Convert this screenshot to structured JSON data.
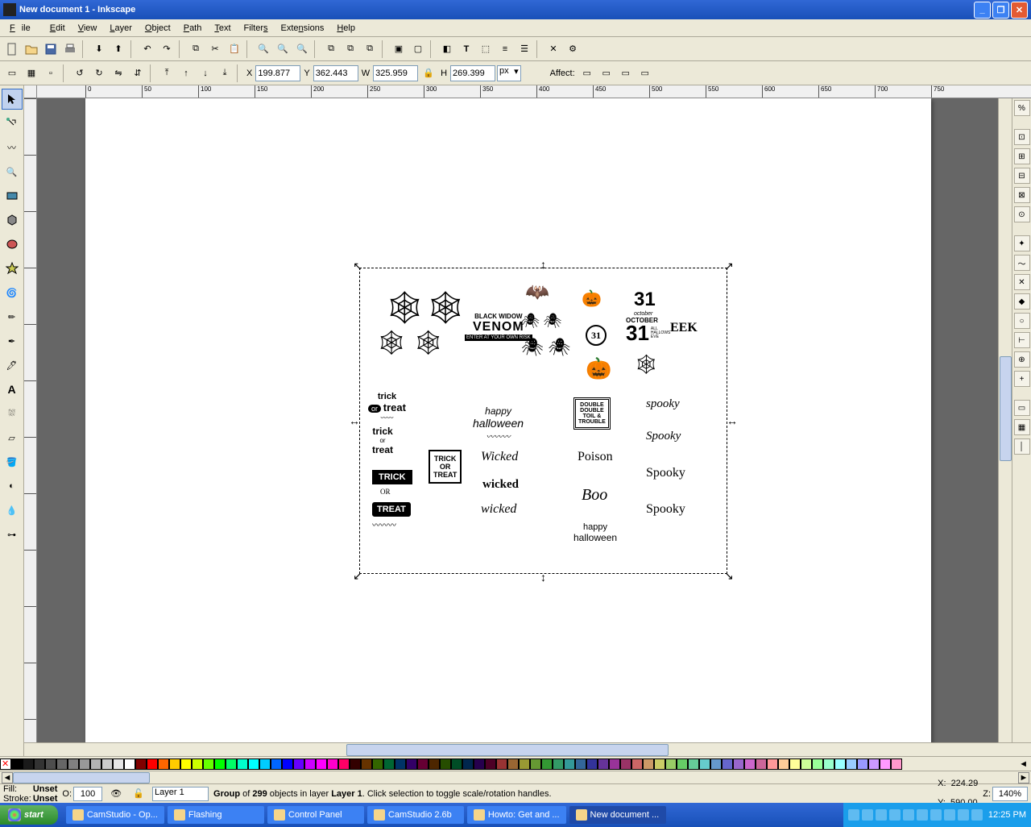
{
  "window": {
    "title": "New document 1 - Inkscape"
  },
  "menu": {
    "file": "File",
    "edit": "Edit",
    "view": "View",
    "layer": "Layer",
    "object": "Object",
    "path": "Path",
    "text": "Text",
    "filters": "Filters",
    "extensions": "Extensions",
    "help": "Help"
  },
  "coords": {
    "x_label": "X",
    "x": "199.877",
    "y_label": "Y",
    "y": "362.443",
    "w_label": "W",
    "w": "325.959",
    "h_label": "H",
    "h": "269.399",
    "unit": "px",
    "affect_label": "Affect:"
  },
  "status": {
    "fill_label": "Fill:",
    "fill_value": "Unset",
    "stroke_label": "Stroke:",
    "stroke_value": "Unset",
    "opacity_label": "O:",
    "opacity": "100",
    "layer": "Layer 1",
    "msg_prefix": "Group",
    "msg_of": " of ",
    "msg_count": "299",
    "msg_mid": " objects in layer ",
    "msg_layer": "Layer 1",
    "msg_tail": ". Click selection to toggle scale/rotation handles.",
    "cursor_x_label": "X:",
    "cursor_x": "224.29",
    "cursor_y_label": "Y:",
    "cursor_y": "590.00",
    "zoom_label": "Z:",
    "zoom": "140%"
  },
  "taskbar": {
    "start": "start",
    "items": [
      "CamStudio - Op...",
      "Flashing",
      "Control Panel",
      "CamStudio 2.6b",
      "Howto: Get and ...",
      "New document ..."
    ],
    "clock": "12:25 PM"
  },
  "clipart": {
    "venom1": "BLACK WIDOW",
    "venom2": "VENOM",
    "venom3": "ENTER AT YOUR OWN RISK",
    "thirtyone": "31",
    "oct_small": "october",
    "oct_word": "OCTOBER",
    "oct_big": "31",
    "oct_sub": "ALL\nHALLOWS\nEVE",
    "eek": "EEK",
    "trick1": "trick",
    "or1": "or",
    "treat1": "treat",
    "trick2": "trick",
    "or2": "or",
    "treat2": "treat",
    "trickbox": "TRICK\nOR\nTREAT",
    "trick3": "TRICK",
    "or3": "OR",
    "treat3": "TREAT",
    "trick4": "TRICK\nor\nTREAT",
    "happyh1": "happy",
    "happyh2": "halloween",
    "wicked1": "Wicked",
    "wicked2": "wicked",
    "wicked3": "wicked",
    "double": "DOUBLE\nDOUBLE\nTOIL &\nTROUBLE",
    "poison": "Poison",
    "boo": "Boo",
    "happyh3": "happy",
    "happyh4": "halloween",
    "spooky1": "spooky",
    "spooky2": "Spooky",
    "spooky3": "Spooky",
    "spooky4": "Spooky"
  },
  "ruler_marks": [
    "0",
    "50",
    "100",
    "150",
    "200",
    "250",
    "300",
    "350",
    "400",
    "450",
    "500",
    "550",
    "600",
    "650",
    "700",
    "750"
  ],
  "palette_colors": [
    "#000000",
    "#1a1a1a",
    "#333333",
    "#4d4d4d",
    "#666666",
    "#808080",
    "#999999",
    "#b3b3b3",
    "#cccccc",
    "#e6e6e6",
    "#ffffff",
    "#800000",
    "#ff0000",
    "#ff6600",
    "#ffcc00",
    "#ffff00",
    "#ccff00",
    "#66ff00",
    "#00ff00",
    "#00ff66",
    "#00ffcc",
    "#00ffff",
    "#00ccff",
    "#0066ff",
    "#0000ff",
    "#6600ff",
    "#cc00ff",
    "#ff00ff",
    "#ff00cc",
    "#ff0066",
    "#330000",
    "#663300",
    "#336600",
    "#006633",
    "#003366",
    "#330066",
    "#660033",
    "#4d2600",
    "#264d00",
    "#004d26",
    "#00264d",
    "#26004d",
    "#4d0026",
    "#993333",
    "#996633",
    "#999933",
    "#669933",
    "#339933",
    "#339966",
    "#339999",
    "#336699",
    "#333399",
    "#663399",
    "#993399",
    "#993366",
    "#cc6666",
    "#cc9966",
    "#cccc66",
    "#99cc66",
    "#66cc66",
    "#66cc99",
    "#66cccc",
    "#6699cc",
    "#6666cc",
    "#9966cc",
    "#cc66cc",
    "#cc6699",
    "#ff9999",
    "#ffcc99",
    "#ffff99",
    "#ccff99",
    "#99ff99",
    "#99ffcc",
    "#99ffff",
    "#99ccff",
    "#9999ff",
    "#cc99ff",
    "#ff99ff",
    "#ff99cc"
  ]
}
